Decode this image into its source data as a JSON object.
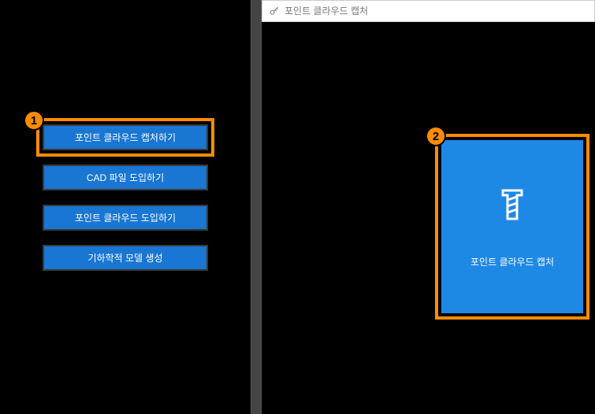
{
  "search": {
    "placeholder": "포인트 클라우드 캡처"
  },
  "sidebar": {
    "buttons": {
      "capture": "포인트 클라우드 캡처하기",
      "cad_import": "CAD 파일 도입하기",
      "cloud_import": "포인트 클라우드 도입하기",
      "geo_model": "기하학적 모델 생성"
    }
  },
  "tile": {
    "label": "포인트 클라우드 캡처"
  },
  "callouts": {
    "c1": "1",
    "c2": "2"
  }
}
